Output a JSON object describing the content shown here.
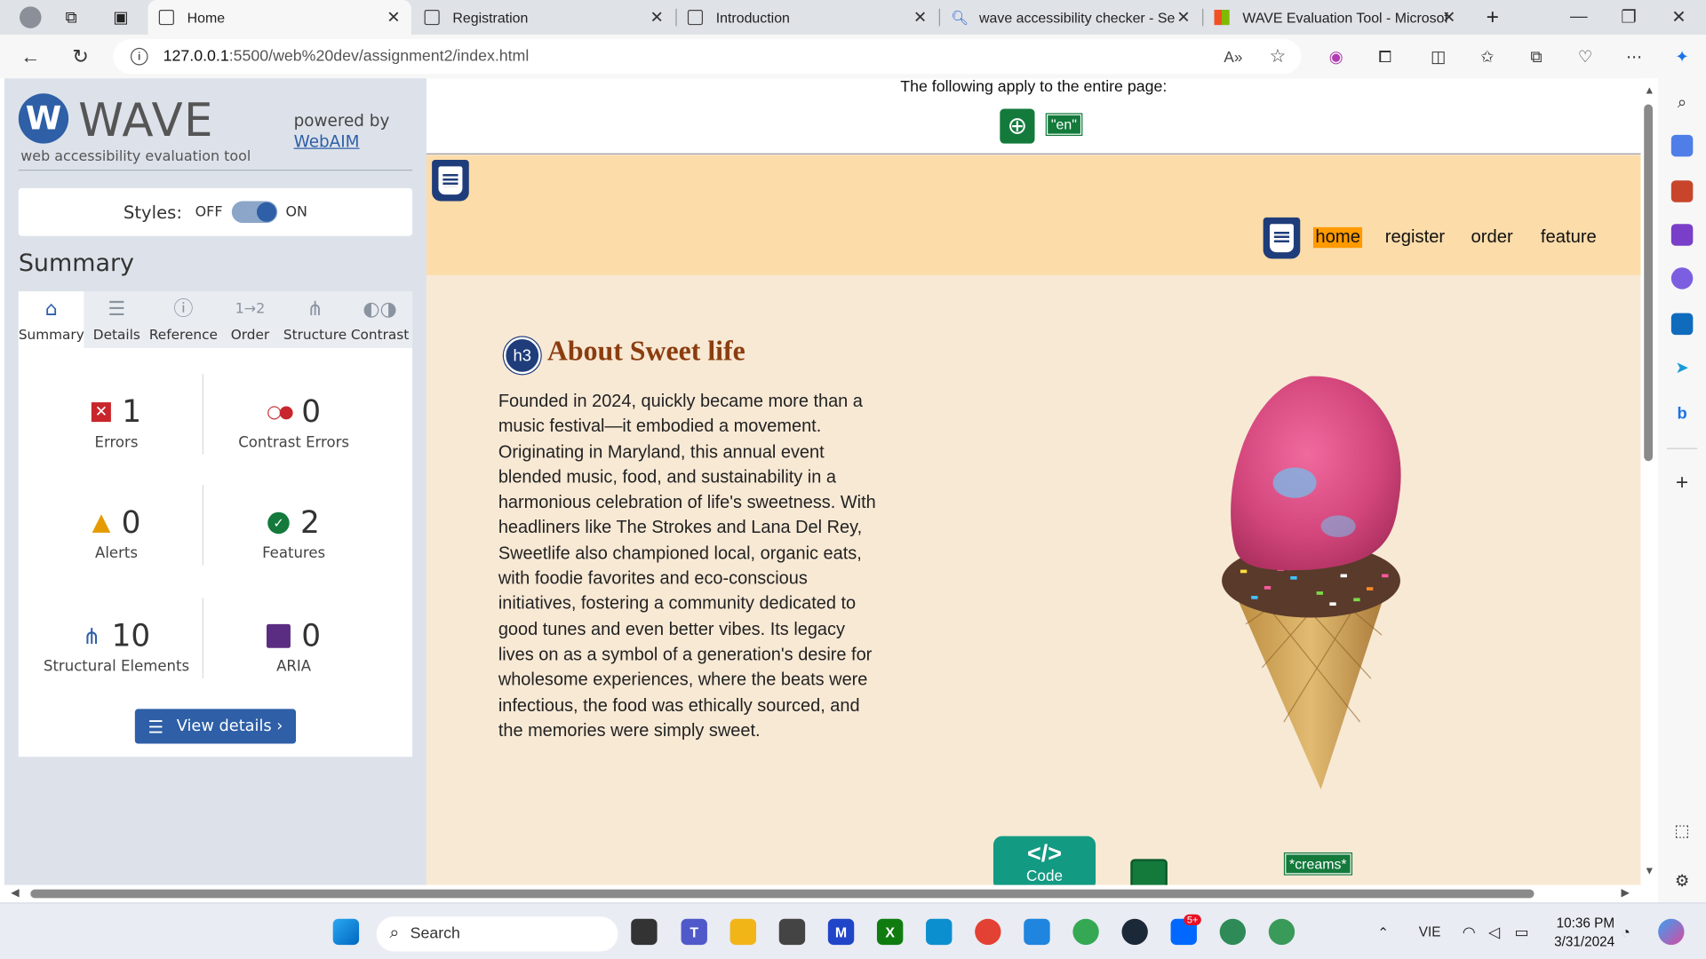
{
  "browser": {
    "tabs": [
      {
        "label": "Home",
        "active": true
      },
      {
        "label": "Registration",
        "active": false
      },
      {
        "label": "Introduction",
        "active": false
      },
      {
        "label": "wave accessibility checker - Sear",
        "active": false
      },
      {
        "label": "WAVE Evaluation Tool - Microsof",
        "active": false
      }
    ],
    "url_host": "127.0.0.1",
    "url_path": ":5500/web%20dev/assignment2/index.html"
  },
  "wave": {
    "title": "WAVE",
    "subtitle": "web accessibility evaluation tool",
    "powered_by": "powered by",
    "webaim": "WebAIM",
    "styles_label": "Styles:",
    "styles_off": "OFF",
    "styles_on": "ON",
    "summary_heading": "Summary",
    "tabs": [
      "Summary",
      "Details",
      "Reference",
      "Order",
      "Structure",
      "Contrast"
    ],
    "stats": {
      "errors": {
        "value": "1",
        "label": "Errors"
      },
      "contrast": {
        "value": "0",
        "label": "Contrast Errors"
      },
      "alerts": {
        "value": "0",
        "label": "Alerts"
      },
      "features": {
        "value": "2",
        "label": "Features"
      },
      "structural": {
        "value": "10",
        "label": "Structural Elements"
      },
      "aria": {
        "value": "0",
        "label": "ARIA"
      }
    },
    "view_details": "View details ›",
    "colors": {
      "accent": "#2e5fa7",
      "error": "#c8262c",
      "feature": "#137a3c",
      "alert": "#e59b00",
      "aria": "#5a2d82"
    }
  },
  "page": {
    "applies_text": "The following apply to the entire page:",
    "lang_badge": "\"en\"",
    "nav": [
      "home",
      "register",
      "order",
      "feature"
    ],
    "h3_badge": "h3",
    "heading": "About Sweet life",
    "paragraph": "Founded in 2024, quickly became more than a music festival—it embodied a movement. Originating in Maryland, this annual event blended music, food, and sustainability in a harmonious celebration of life's sweetness. With headliners like The Strokes and Lana Del Rey, Sweetlife also championed local, organic eats, with foodie favorites and eco-conscious initiatives, fostering a community dedicated to good tunes and even better vibes. Its legacy lives on as a symbol of a generation's desire for wholesome experiences, where the beats were infectious, the food was ethically sourced, and the memories were simply sweet.",
    "code_label": "Code",
    "code_tag": "</>",
    "creams_badge": "*creams*",
    "colors": {
      "header_bg": "#fcdca9",
      "page_bg": "#f8e9d5",
      "heading": "#8b3d0f",
      "nav_highlight": "#ff9a00"
    }
  },
  "taskbar": {
    "search_placeholder": "Search",
    "lang": "VIE",
    "time": "10:36 PM",
    "date": "3/31/2024",
    "zalo_badge": "5+"
  }
}
